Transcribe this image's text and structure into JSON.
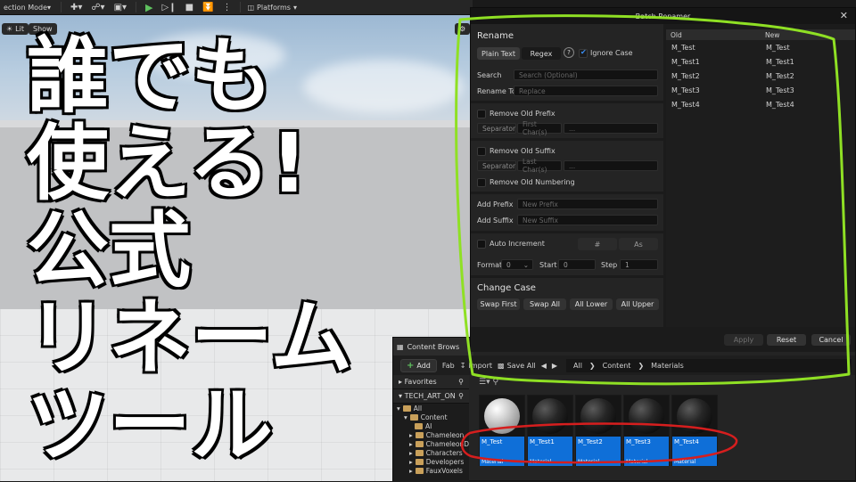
{
  "toolbar": {
    "mode_label": "ection Mode",
    "platforms_label": "Platforms"
  },
  "viewport": {
    "lit_label": "Lit",
    "show_label": "Show"
  },
  "overlay_title": [
    "誰でも",
    "使える!",
    "公式",
    "リネーム",
    "ツール"
  ],
  "batch_renamer": {
    "title": "Batch Renamer",
    "rename_section": "Rename",
    "plain_text_tab": "Plain Text",
    "regex_tab": "Regex",
    "help_icon": "?",
    "ignore_case_label": "Ignore Case",
    "search_label": "Search",
    "search_placeholder": "Search (Optional)",
    "rename_to_label": "Rename To",
    "rename_to_placeholder": "Replace",
    "remove_old_prefix_label": "Remove Old Prefix",
    "separator_label": "Separator",
    "first_chars_label": "First Char(s)",
    "ellipsis": "...",
    "remove_old_suffix_label": "Remove Old Suffix",
    "last_chars_label": "Last Char(s)",
    "remove_old_numbering_label": "Remove Old Numbering",
    "add_prefix_label": "Add Prefix",
    "add_prefix_placeholder": "New Prefix",
    "add_suffix_label": "Add Suffix",
    "add_suffix_placeholder": "New Suffix",
    "auto_increment_label": "Auto Increment",
    "hash_label": "#",
    "as_label": "As",
    "format_label": "Format",
    "format_value": "0",
    "start_label": "Start",
    "start_value": "0",
    "step_label": "Step",
    "step_value": "1",
    "change_case_section": "Change Case",
    "swap_first_label": "Swap First",
    "swap_all_label": "Swap All",
    "all_lower_label": "All Lower",
    "all_upper_label": "All Upper",
    "col_old": "Old",
    "col_new": "New",
    "rows": [
      {
        "old": "M_Test",
        "new": "M_Test"
      },
      {
        "old": "M_Test1",
        "new": "M_Test1"
      },
      {
        "old": "M_Test2",
        "new": "M_Test2"
      },
      {
        "old": "M_Test3",
        "new": "M_Test3"
      },
      {
        "old": "M_Test4",
        "new": "M_Test4"
      }
    ],
    "apply_label": "Apply",
    "reset_label": "Reset",
    "cancel_label": "Cancel"
  },
  "content_browser": {
    "tab_label": "Content Brows",
    "add_label": "Add",
    "import_label": "Import",
    "save_all_label": "Save All",
    "fab_label": "Fab",
    "crumbs": [
      "All",
      "Content",
      "Materials"
    ],
    "favorites_label": "Favorites",
    "project_label": "TECH_ART_ON",
    "tree": [
      "All",
      "Content",
      "AI",
      "Chameleon",
      "ChameleonD",
      "Characters",
      "Developers",
      "FauxVoxels"
    ],
    "assets": [
      {
        "name": "M_Test",
        "type": "Material"
      },
      {
        "name": "M_Test1",
        "type": "Material"
      },
      {
        "name": "M_Test2",
        "type": "Material"
      },
      {
        "name": "M_Test3",
        "type": "Material"
      },
      {
        "name": "M_Test4",
        "type": "Material"
      }
    ]
  },
  "colors": {
    "highlight_green": "#8fe024",
    "highlight_red": "#d61e1e",
    "selection_blue": "#0f6fd8"
  }
}
